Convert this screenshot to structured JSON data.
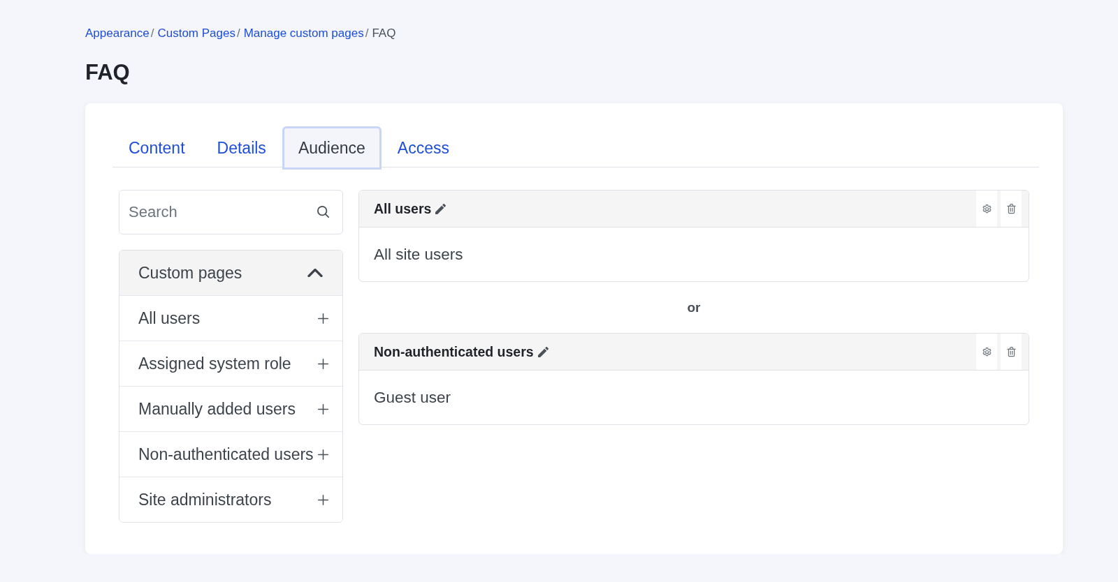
{
  "breadcrumb": {
    "separator": "/",
    "items": [
      {
        "label": "Appearance",
        "kind": "link"
      },
      {
        "label": "Custom Pages",
        "kind": "link"
      },
      {
        "label": "Manage custom pages",
        "kind": "link"
      },
      {
        "label": "FAQ",
        "kind": "current"
      }
    ]
  },
  "title": "FAQ",
  "tabs": [
    {
      "label": "Content",
      "selected": false
    },
    {
      "label": "Details",
      "selected": false
    },
    {
      "label": "Audience",
      "selected": true
    },
    {
      "label": "Access",
      "selected": false
    }
  ],
  "search": {
    "placeholder": "Search"
  },
  "sidebar": {
    "group": {
      "label": "Custom pages",
      "expanded": true
    },
    "items": [
      {
        "label": "All users"
      },
      {
        "label": "Assigned system role"
      },
      {
        "label": "Manually added users"
      },
      {
        "label": "Non-authenticated users"
      },
      {
        "label": "Site administrators"
      }
    ]
  },
  "rules": [
    {
      "title": "All users",
      "description": "All site users"
    },
    {
      "title": "Non-authenticated users",
      "description": "Guest user"
    }
  ],
  "connector": "or"
}
